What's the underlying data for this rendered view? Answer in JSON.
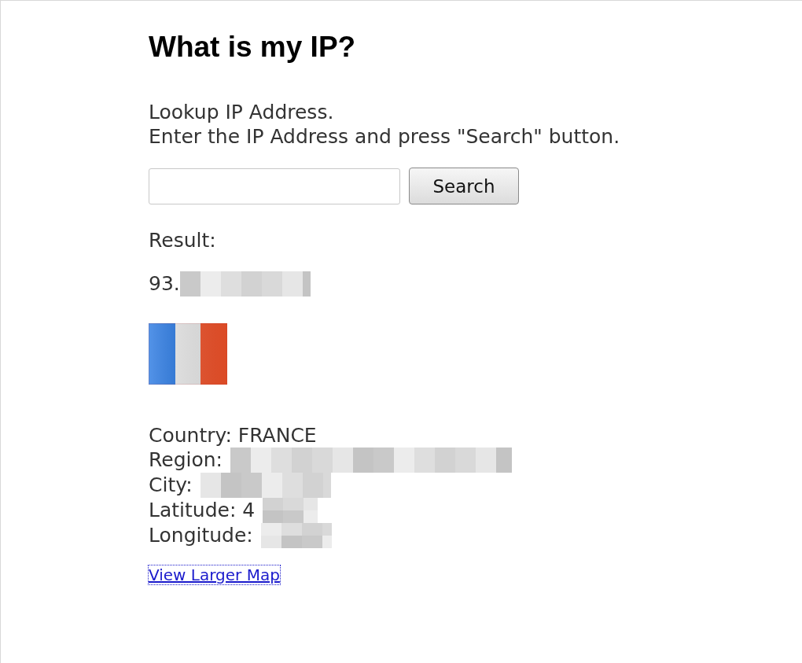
{
  "title": "What is my IP?",
  "intro": [
    "Lookup IP Address.",
    "Enter the IP Address and press \"Search\" button."
  ],
  "search": {
    "button": "Search"
  },
  "result_label": "Result:",
  "result": {
    "text": "93.",
    "redacted": true
  },
  "details": [
    {
      "text": "Country: FRANCE",
      "redacted": false
    },
    {
      "text": "Region:",
      "redacted": true
    },
    {
      "text": "City:",
      "redacted": true
    },
    {
      "text": "Latitude: 4",
      "redacted": true
    },
    {
      "text": "Longitude:",
      "redacted": true
    }
  ],
  "map_link": {
    "label": "View Larger Map",
    "focused": true
  }
}
